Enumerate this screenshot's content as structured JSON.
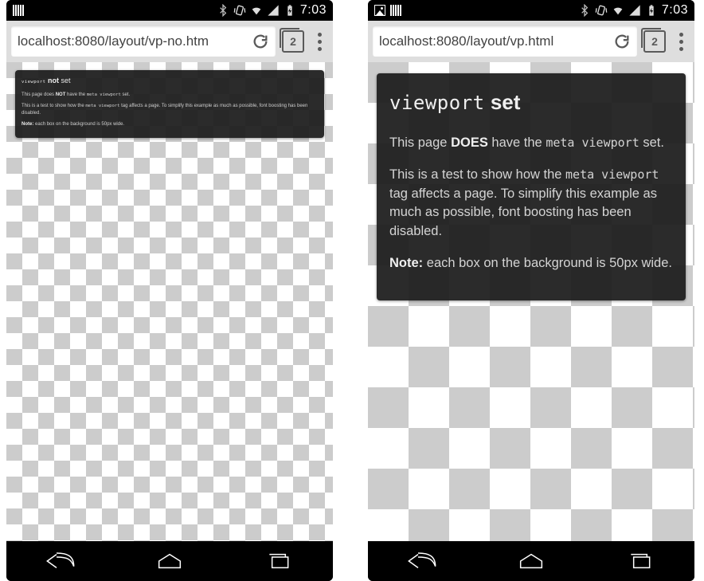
{
  "status": {
    "time": "7:03"
  },
  "toolbar": {
    "tabs_count": "2"
  },
  "left": {
    "url": "localhost:8080/layout/vp-no.htm",
    "content": {
      "h_mono": "viewport",
      "h_bold": "not",
      "h_rest": "set",
      "p1_a": "This page does",
      "p1_bold": "NOT",
      "p1_b": "have the",
      "p1_mono": "meta viewport",
      "p1_c": "set.",
      "p2_a": "This is a test to show how the",
      "p2_mono": "meta viewport",
      "p2_b": "tag affects a page. To simplify this example as much as possible, font boosting has been disabled.",
      "p3_bold": "Note:",
      "p3": "each box on the background is 50px wide."
    }
  },
  "right": {
    "url": "localhost:8080/layout/vp.html",
    "content": {
      "h_mono": "viewport",
      "h_bold": "set",
      "p1_a": "This page",
      "p1_bold": "DOES",
      "p1_b": "have the",
      "p1_mono": "meta viewport",
      "p1_c": "set.",
      "p2_a": "This is a test to show how the",
      "p2_mono": "meta viewport",
      "p2_b": "tag affects a page. To simplify this example as much as possible, font boosting has been disabled.",
      "p3_bold": "Note:",
      "p3": "each box on the background is 50px wide."
    }
  }
}
